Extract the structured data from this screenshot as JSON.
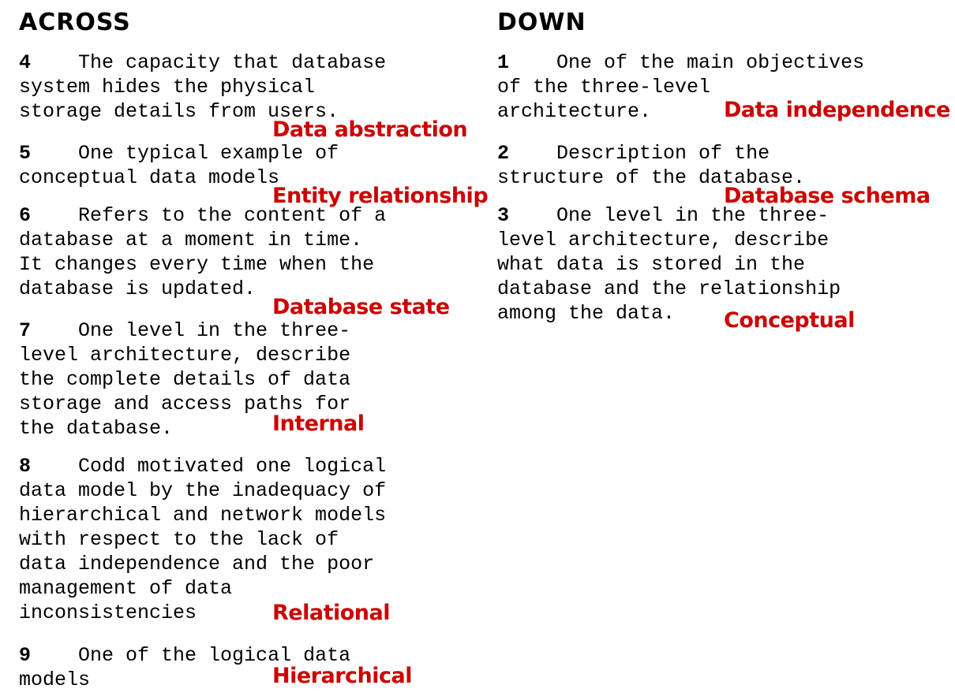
{
  "across": {
    "heading": "ACROSS",
    "clues": [
      {
        "number": "4",
        "lines": [
          "    The capacity that database",
          "system hides the physical",
          "storage details from users."
        ],
        "answer": "Data abstraction"
      },
      {
        "number": "5",
        "lines": [
          "    One typical example of",
          "conceptual data models"
        ],
        "answer": "Entity relationship"
      },
      {
        "number": "6",
        "lines": [
          "    Refers to the content of a",
          "database at a moment in time.",
          "It changes every time when the",
          "database is updated."
        ],
        "answer": "Database state"
      },
      {
        "number": "7",
        "lines": [
          "    One level in the three-",
          "level architecture, describe",
          "the complete details of data",
          "storage and access paths for",
          "the database."
        ],
        "answer": "Internal"
      },
      {
        "number": "8",
        "lines": [
          "    Codd motivated one logical",
          "data model by the inadequacy of",
          "hierarchical and network models",
          "with respect to the lack of",
          "data independence and the poor",
          "management of data",
          "inconsistencies"
        ],
        "answer": "Relational"
      },
      {
        "number": "9",
        "lines": [
          "    One of the logical data",
          "models"
        ],
        "answer": "Hierarchical"
      }
    ]
  },
  "down": {
    "heading": "DOWN",
    "clues": [
      {
        "number": "1",
        "lines": [
          "    One of the main objectives",
          "of the three-level",
          "architecture."
        ],
        "answer": "Data independence"
      },
      {
        "number": "2",
        "lines": [
          "    Description of the",
          "structure of the database."
        ],
        "answer": "Database schema"
      },
      {
        "number": "3",
        "lines": [
          "    One level in the three-",
          "level architecture, describe",
          "what data is stored in the",
          "database and the relationship",
          "among the data."
        ],
        "answer": "Conceptual"
      }
    ]
  }
}
